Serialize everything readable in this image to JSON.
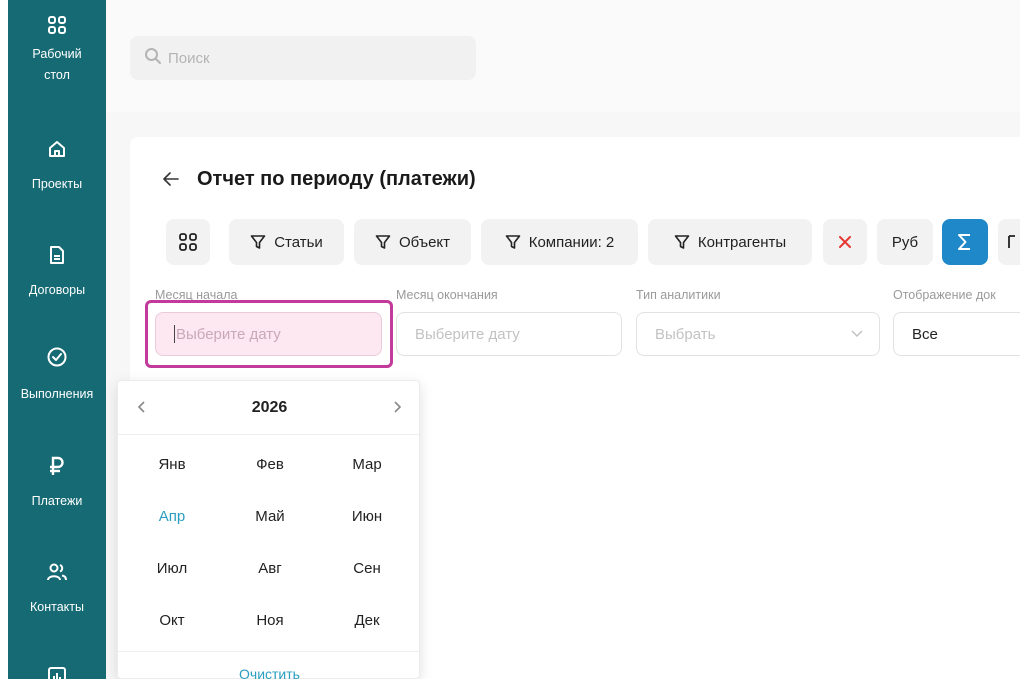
{
  "sidebar": {
    "items": [
      {
        "label": "Рабочий\nстол",
        "icon": "dashboard-icon"
      },
      {
        "label": "Проекты",
        "icon": "home-icon"
      },
      {
        "label": "Договоры",
        "icon": "document-icon"
      },
      {
        "label": "Выполнения",
        "icon": "check-circle-icon"
      },
      {
        "label": "Платежи",
        "icon": "ruble-icon"
      },
      {
        "label": "Контакты",
        "icon": "users-icon"
      },
      {
        "label": "",
        "icon": "report-icon"
      }
    ]
  },
  "search": {
    "placeholder": "Поиск"
  },
  "page": {
    "back_icon": "arrow-left-icon",
    "title": "Отчет по периоду (платежи)"
  },
  "toolbar": {
    "filters": [
      "Статьи",
      "Объект",
      "Компании: 2",
      "Контрагенты"
    ],
    "currency": "Руб",
    "accent": "#1e88c9",
    "clear_color": "#e53935"
  },
  "fields": {
    "start_month": {
      "label": "Месяц начала",
      "placeholder": "Выберите дату"
    },
    "end_month": {
      "label": "Месяц окончания",
      "placeholder": "Выберите дату"
    },
    "analytics_type": {
      "label": "Тип аналитики",
      "placeholder": "Выбрать"
    },
    "display": {
      "label": "Отображение док",
      "value": "Все"
    }
  },
  "calendar": {
    "year": "2026",
    "months": [
      "Янв",
      "Фев",
      "Мар",
      "Апр",
      "Май",
      "Июн",
      "Июл",
      "Авг",
      "Сен",
      "Окт",
      "Ноя",
      "Дек"
    ],
    "current_month_color": "#2a9ec1",
    "clear_label": "Очистить"
  },
  "colors": {
    "sidebar": "#166a73",
    "highlight": "#c23a9a"
  }
}
